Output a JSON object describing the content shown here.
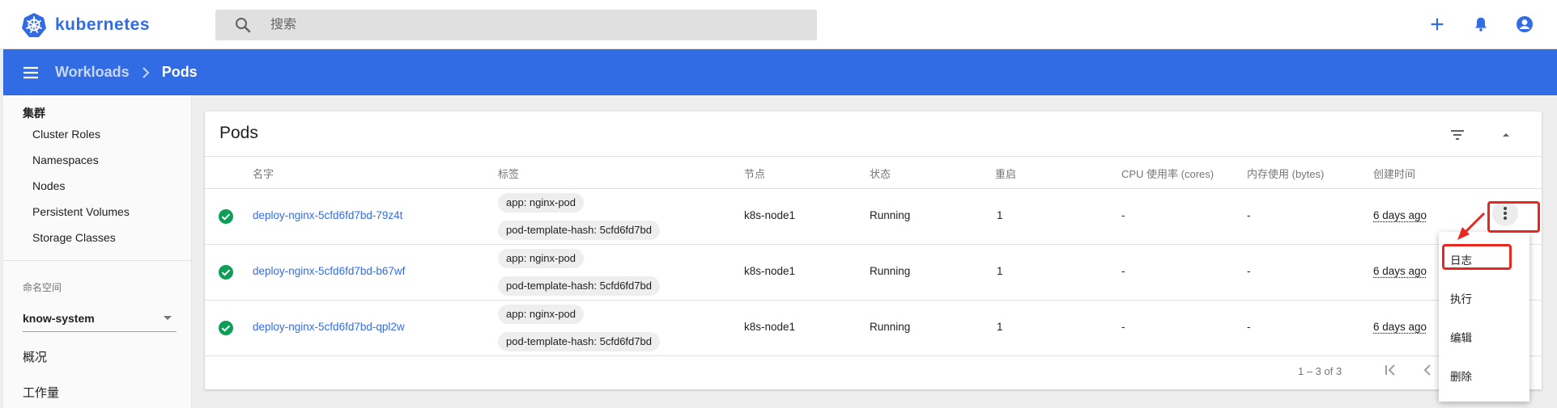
{
  "app": {
    "name": "kubernetes",
    "brand_color": "#326ce5"
  },
  "search": {
    "placeholder": "搜索"
  },
  "topbar": {
    "icons": [
      "plus-icon",
      "bell-icon",
      "account-icon"
    ]
  },
  "breadcrumb": {
    "parent": "Workloads",
    "current": "Pods"
  },
  "sidebar": {
    "cluster_heading": "集群",
    "cluster_items": [
      "Cluster Roles",
      "Namespaces",
      "Nodes",
      "Persistent Volumes",
      "Storage Classes"
    ],
    "namespace_label": "命名空间",
    "namespace_value": "know-system",
    "overview": "概况",
    "workloads": "工作量"
  },
  "card": {
    "title": "Pods",
    "columns": [
      "名字",
      "标签",
      "节点",
      "状态",
      "重启",
      "CPU 使用率 (cores)",
      "内存使用 (bytes)",
      "创建时间"
    ],
    "rows": [
      {
        "name": "deploy-nginx-5cfd6fd7bd-79z4t",
        "labels": [
          "app: nginx-pod",
          "pod-template-hash: 5cfd6fd7bd"
        ],
        "node": "k8s-node1",
        "status": "Running",
        "restarts": "1",
        "cpu": "-",
        "memory": "-",
        "age": "6 days ago"
      },
      {
        "name": "deploy-nginx-5cfd6fd7bd-b67wf",
        "labels": [
          "app: nginx-pod",
          "pod-template-hash: 5cfd6fd7bd"
        ],
        "node": "k8s-node1",
        "status": "Running",
        "restarts": "1",
        "cpu": "-",
        "memory": "-",
        "age": "6 days ago"
      },
      {
        "name": "deploy-nginx-5cfd6fd7bd-qpl2w",
        "labels": [
          "app: nginx-pod",
          "pod-template-hash: 5cfd6fd7bd"
        ],
        "node": "k8s-node1",
        "status": "Running",
        "restarts": "1",
        "cpu": "-",
        "memory": "-",
        "age": "6 days ago"
      }
    ],
    "pagination": "1 – 3 of 3"
  },
  "context_menu": {
    "items": [
      "日志",
      "执行",
      "编辑",
      "删除"
    ]
  },
  "colors": {
    "status_ok": "#0f9d58",
    "annotation": "#e8281e",
    "header": "#326ce5"
  }
}
